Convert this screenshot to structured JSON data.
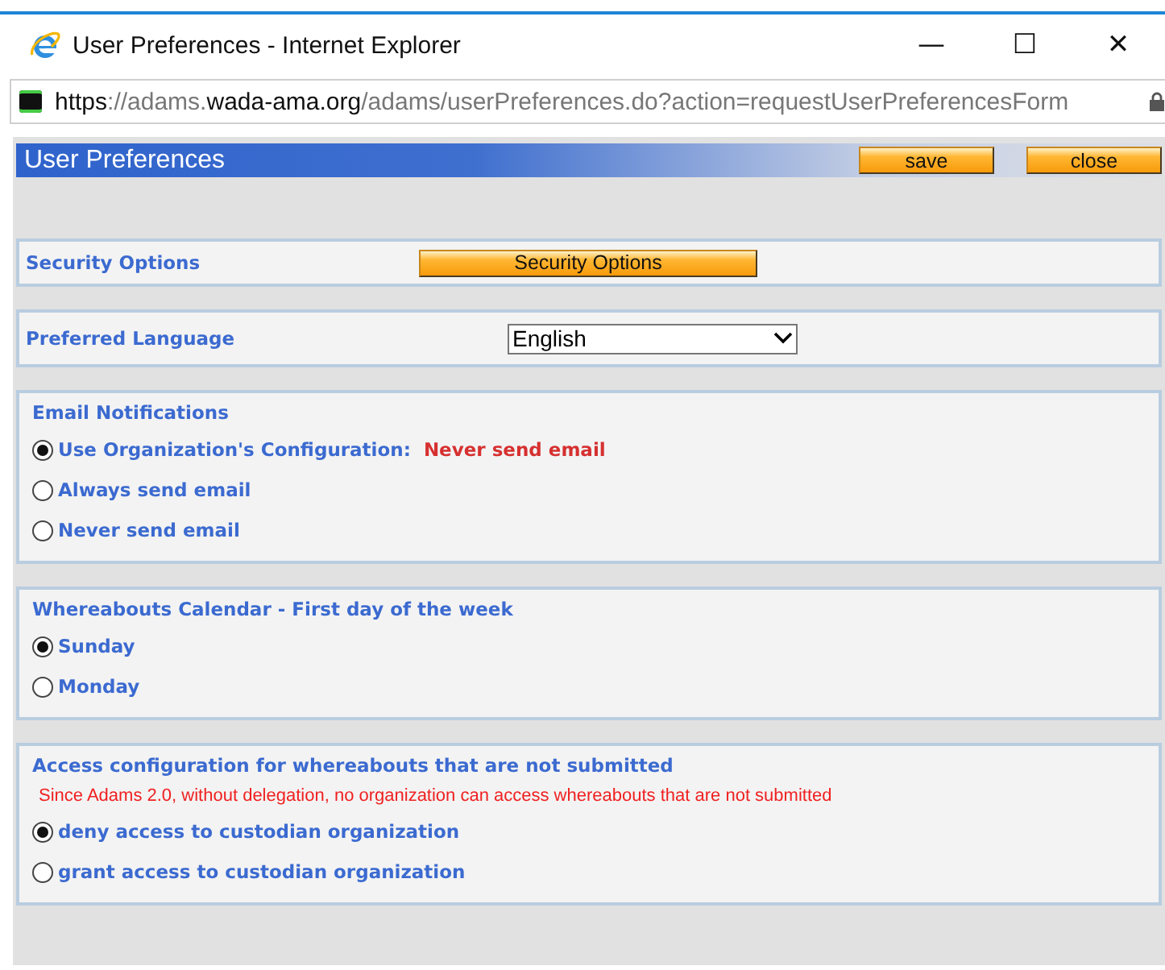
{
  "window": {
    "title": "User Preferences - Internet Explorer",
    "controls": [
      "—",
      "☐",
      "✕"
    ]
  },
  "address_bar": {
    "url_parts": [
      {
        "text": "https",
        "strong": true
      },
      {
        "text": "://adams.",
        "strong": false
      },
      {
        "text": "wada-ama.org",
        "strong": true
      },
      {
        "text": "/adams/userPreferences.do?action=requestUserPreferencesForm",
        "strong": false
      }
    ]
  },
  "header": {
    "title": "User Preferences",
    "buttons": [
      "save",
      "close"
    ]
  },
  "sections": [
    {
      "kind": "button",
      "label": "Security Options",
      "button": "Security Options"
    },
    {
      "kind": "select",
      "label": "Preferred Language",
      "value": "English"
    },
    {
      "kind": "radios",
      "title": "Email Notifications",
      "options": [
        {
          "label": "Use Organization's Configuration:",
          "note": "Never send email",
          "selected": true
        },
        {
          "label": "Always send email",
          "selected": false
        },
        {
          "label": "Never send email",
          "selected": false
        }
      ]
    },
    {
      "kind": "radios",
      "title": "Whereabouts Calendar - First day of the week",
      "options": [
        {
          "label": "Sunday",
          "selected": true
        },
        {
          "label": "Monday",
          "selected": false
        }
      ]
    },
    {
      "kind": "radios",
      "title": "Access configuration for whereabouts that are not submitted",
      "warning": "Since Adams 2.0, without delegation, no organization can access whereabouts that are not submitted",
      "options": [
        {
          "label": "deny access to custodian organization",
          "selected": true
        },
        {
          "label": "grant access to custodian organization",
          "selected": false
        }
      ]
    }
  ]
}
